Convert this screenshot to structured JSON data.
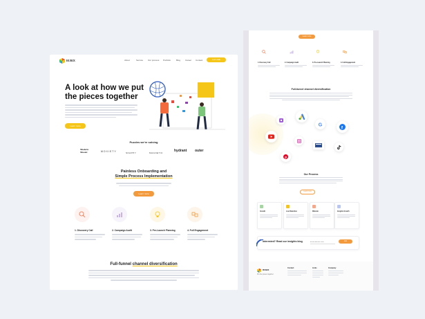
{
  "left": {
    "nav": {
      "logo_text": "RUBIX",
      "links": [
        "About",
        "Service",
        "Our process",
        "Portfolio",
        "Blog",
        "Career",
        "Contact"
      ],
      "cta": "Let's talk"
    },
    "hero": {
      "title_line1": "A look at how we put",
      "title_line2": "the pieces together",
      "button": "Learn more"
    },
    "partners": {
      "heading": "Puzzles we're solving",
      "logos": [
        "Modern Mosaic",
        "MOXIETY",
        "SNAPPY",
        "MAGNETIC",
        "hydrant",
        "outer"
      ]
    },
    "onboarding": {
      "title_line1": "Painless Onboarding and",
      "title_line2": "Simple Process Implementation",
      "button": "Learn more"
    },
    "steps": [
      {
        "label": "1. Discovery Call",
        "icon": "search-icon"
      },
      {
        "label": "2. Campaign Audit",
        "icon": "chart-icon"
      },
      {
        "label": "3. Pre-Launch Planning",
        "icon": "lightbulb-icon"
      },
      {
        "label": "4. Full Engagement",
        "icon": "puzzle-icon"
      }
    ],
    "bottom_heading_plain": "Full-funnel",
    "bottom_heading_highlight": "channel diversification"
  },
  "right": {
    "top_button": "Learn more",
    "steps": [
      {
        "label": "1. Discovery Call"
      },
      {
        "label": "2. Campaign Audit"
      },
      {
        "label": "3. Pre-Launch Planning"
      },
      {
        "label": "4. Full Engagement"
      }
    ],
    "channel_heading": "Full-funnel channel diversification",
    "channels": [
      "podcasts-icon",
      "google-ads-icon",
      "google-icon",
      "facebook-icon",
      "youtube-icon",
      "instagram-icon",
      "linkedin-icon",
      "tiktok-icon",
      "pinterest-icon"
    ],
    "process_heading": "Our Process",
    "process_button": "Learn more",
    "cards": [
      {
        "title": "Growth"
      },
      {
        "title": "Low Retention"
      },
      {
        "title": "Website"
      },
      {
        "title": "Insights Growth"
      }
    ],
    "newsletter": {
      "heading": "Interested? Read our insights blog",
      "input_placeholder": "Email address here",
      "button": "Join"
    },
    "footer": {
      "brand": "RUBIX",
      "tagline": "Put the pieces together",
      "col1_title": "Contact",
      "col2_title": "Links",
      "col3_title": "Company"
    }
  },
  "colors": {
    "accent_yellow": "#f5c518",
    "accent_orange": "#f39a3c",
    "page_bg": "#eef1f5",
    "right_page_bg": "#e8e4ec"
  }
}
